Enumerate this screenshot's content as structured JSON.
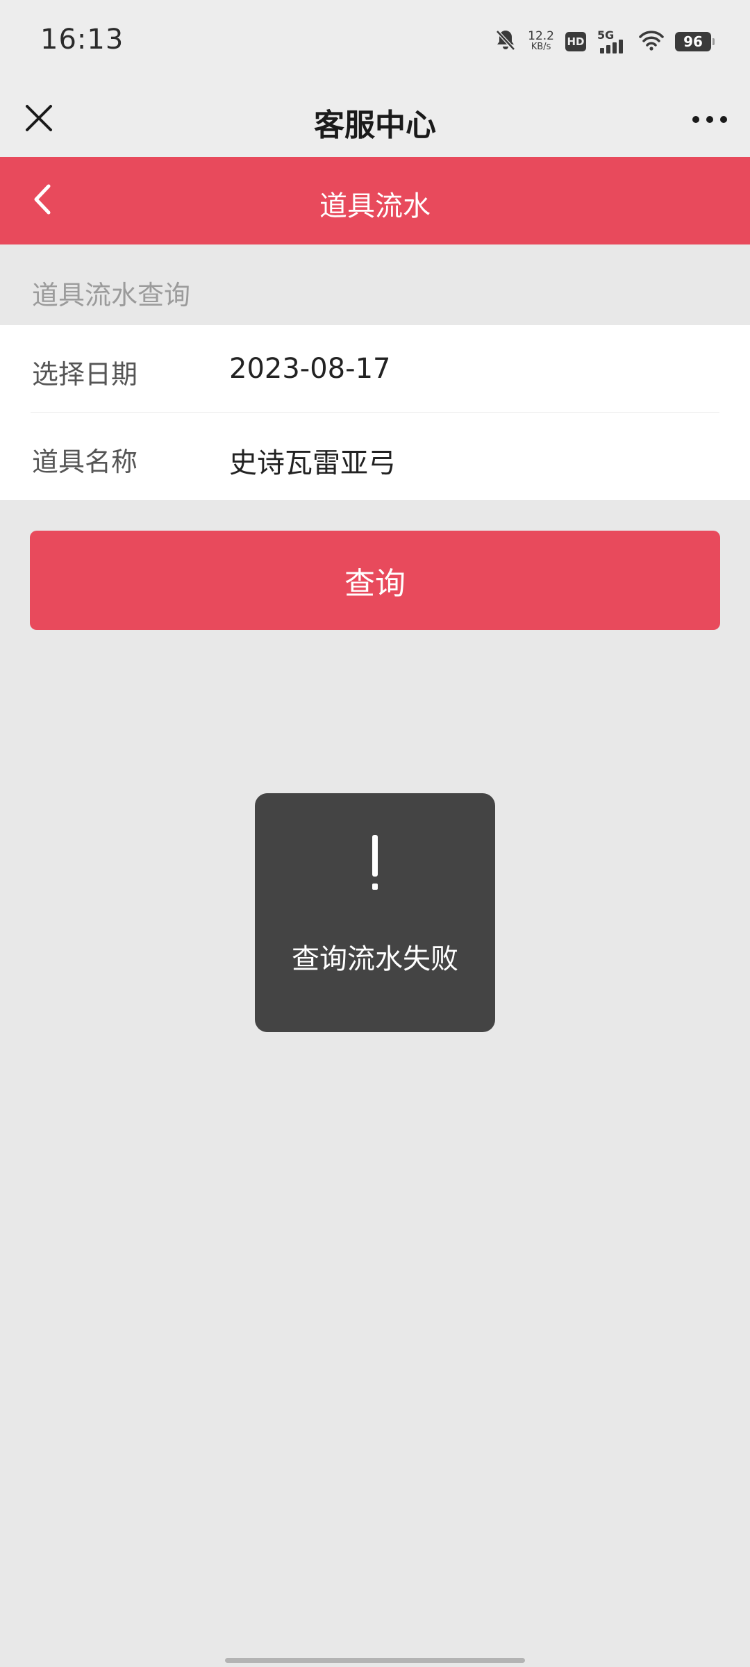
{
  "status_bar": {
    "time": "16:13",
    "net_speed_value": "12.2",
    "net_speed_unit": "KB/s",
    "hd_label": "HD",
    "network_label": "5G",
    "battery_level": "96",
    "icons": [
      "bell-muted-icon",
      "hd-icon",
      "signal-5g-icon",
      "wifi-icon",
      "battery-icon"
    ]
  },
  "title_bar": {
    "title": "客服中心",
    "close_icon": "close-icon",
    "more_icon": "more-dots-icon"
  },
  "header": {
    "title": "道具流水",
    "back_icon": "chevron-left-icon",
    "color": "#e84a5c"
  },
  "query_section": {
    "label": "道具流水查询"
  },
  "form": {
    "rows": [
      {
        "label": "选择日期",
        "value": "2023-08-17"
      },
      {
        "label": "道具名称",
        "value": "史诗瓦雷亚弓"
      }
    ]
  },
  "query_button": {
    "label": "查询",
    "color": "#e84a5c"
  },
  "toast": {
    "icon": "exclamation-icon",
    "message": "查询流水失败"
  }
}
